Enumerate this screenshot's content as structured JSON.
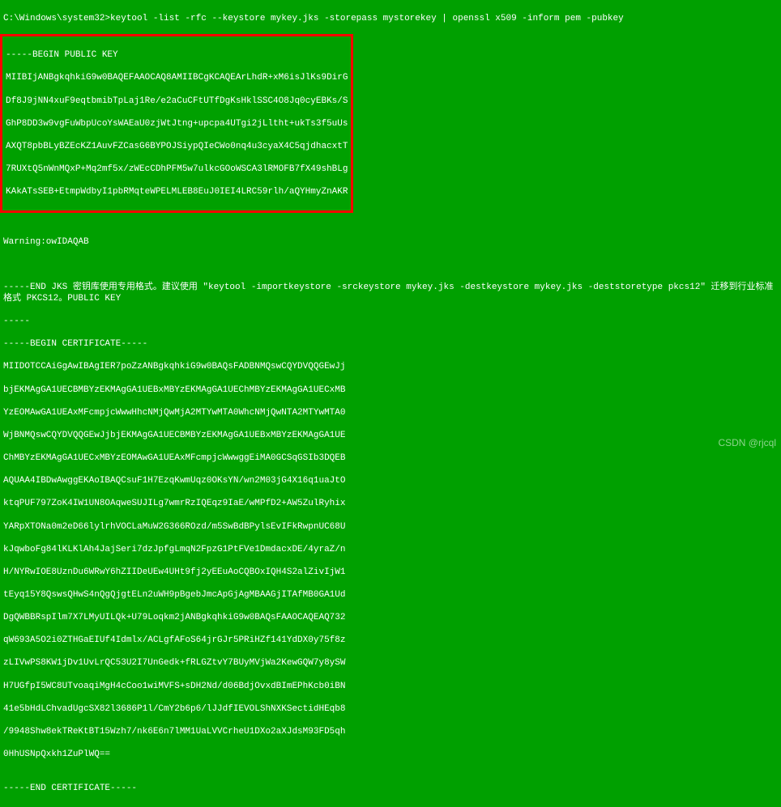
{
  "terminal": {
    "prompt_line": "C:\\Windows\\system32>keytool -list -rfc --keystore mykey.jks -storepass mystorekey | openssl x509 -inform pem -pubkey",
    "highlight_beacon": "-----BEGIN PUBLIC KEY",
    "pubkey_lines": [
      "MIIBIjANBgkqhkiG9w0BAQEFAAOCAQ8AMIIBCgKCAQEArLhdR+xM6isJlKs9DirG",
      "Df8J9jNN4xuF9eqtbmibTpLaj1Re/e2aCuCFtUTfDgKsHklSSC4O8Jq0cyEBKs/S",
      "GhP8DD3w9vgFuWbpUcoYsWAEaU0zjWtJtng+upcpa4UTgi2jLltht+ukTs3f5uUs",
      "AXQT8pbBLyBZEcKZ1AuvFZCasG6BYPOJSiypQIeCWo0nq4u3cyaX4C5qjdhacxtT",
      "7RUXtQ5nWnMQxP+Mq2mf5x/zWEcCDhPFM5w7ulkcGOoWSCA3lRMOFB7fX49shBLg",
      "KAkATsSEB+EtmpWdbyI1pbRMqteWPELMLEB8EuJ0IEI4LRC59rlh/aQYHmyZnAKR"
    ],
    "warning": "Warning:owIDAQAB",
    "blank1": "",
    "end_jks": "-----END JKS 密钥库使用专用格式。建议使用 \"keytool -importkeystore -srckeystore mykey.jks -destkeystore mykey.jks -deststoretype pkcs12\" 迁移到行业标准格式 PKCS12。PUBLIC KEY",
    "dashes": "-----",
    "begin_cert": "-----BEGIN CERTIFICATE-----",
    "cert_lines": [
      "MIIDOTCCAiGgAwIBAgIER7poZzANBgkqhkiG9w0BAQsFADBNMQswCQYDVQQGEwJj",
      "bjEKMAgGA1UECBMBYzEKMAgGA1UEBxMBYzEKMAgGA1UEChMBYzEKMAgGA1UECxMB",
      "YzEOMAwGA1UEAxMFcmpjcWwwHhcNMjQwMjA2MTYwMTA0WhcNMjQwNTA2MTYwMTA0",
      "WjBNMQswCQYDVQQGEwJjbjEKMAgGA1UECBMBYzEKMAgGA1UEBxMBYzEKMAgGA1UE",
      "ChMBYzEKMAgGA1UECxMBYzEOMAwGA1UEAxMFcmpjcWwwggEiMA0GCSqGSIb3DQEB",
      "AQUAA4IBDwAwggEKAoIBAQCsuF1H7EzqKwmUqz0OKsYN/wn2M03jG4X16q1uaJtO",
      "ktqPUF797ZoK4IW1UN8OAqweSUJILg7wmrRzIQEqz9IaE/wMPfD2+AW5ZulRyhix",
      "YARpXTONa0m2eD66lylrhVOCLaMuW2G366ROzd/m5SwBdBPylsEvIFkRwpnUC68U",
      "kJqwboFg84lKLKlAh4JajSeri7dzJpfgLmqN2FpzG1PtFVe1DmdacxDE/4yraZ/n",
      "H/NYRwIOE8UznDu6WRwY6hZIIDeUEw4UHt9fj2yEEuAoCQBOxIQH4S2alZivIjW1",
      "tEyq15Y8QswsQHwS4nQgQjgtELn2uWH9pBgebJmcApGjAgMBAAGjITAfMB0GA1Ud",
      "DgQWBBRspIlm7X7LMyUILQk+U79Loqkm2jANBgkqhkiG9w0BAQsFAAOCAQEAQ732",
      "qW693A5O2i0ZTHGaEIUf4Idmlx/ACLgfAFoS64jrGJr5PRiHZf141YdDX0y75f8z",
      "zLIVwPS8KW1jDv1UvLrQC53U2I7UnGedk+fRLGZtvY7BUyMVjWa2KewGQW7y8ySW",
      "H7UGfpI5WC8UTvoaqiMgH4cCoo1wiMVFS+sDH2Nd/d06BdjOvxdBImEPhKcb0iBN",
      "41e5bHdLChvadUgcSX82l3686P1l/CmY2b6p6/lJJdfIEVOLShNXKSectidHEqb8",
      "/9948Shw8ekTReKtBT15Wzh7/nk6E6n7lMM1UaLVVCrheU1DXo2aXJdsM93FD5qh",
      "0HhUSNpQxkh1ZuPlWQ=="
    ],
    "end_cert": "-----END CERTIFICATE-----"
  },
  "watermark": "CSDN @rjcql"
}
